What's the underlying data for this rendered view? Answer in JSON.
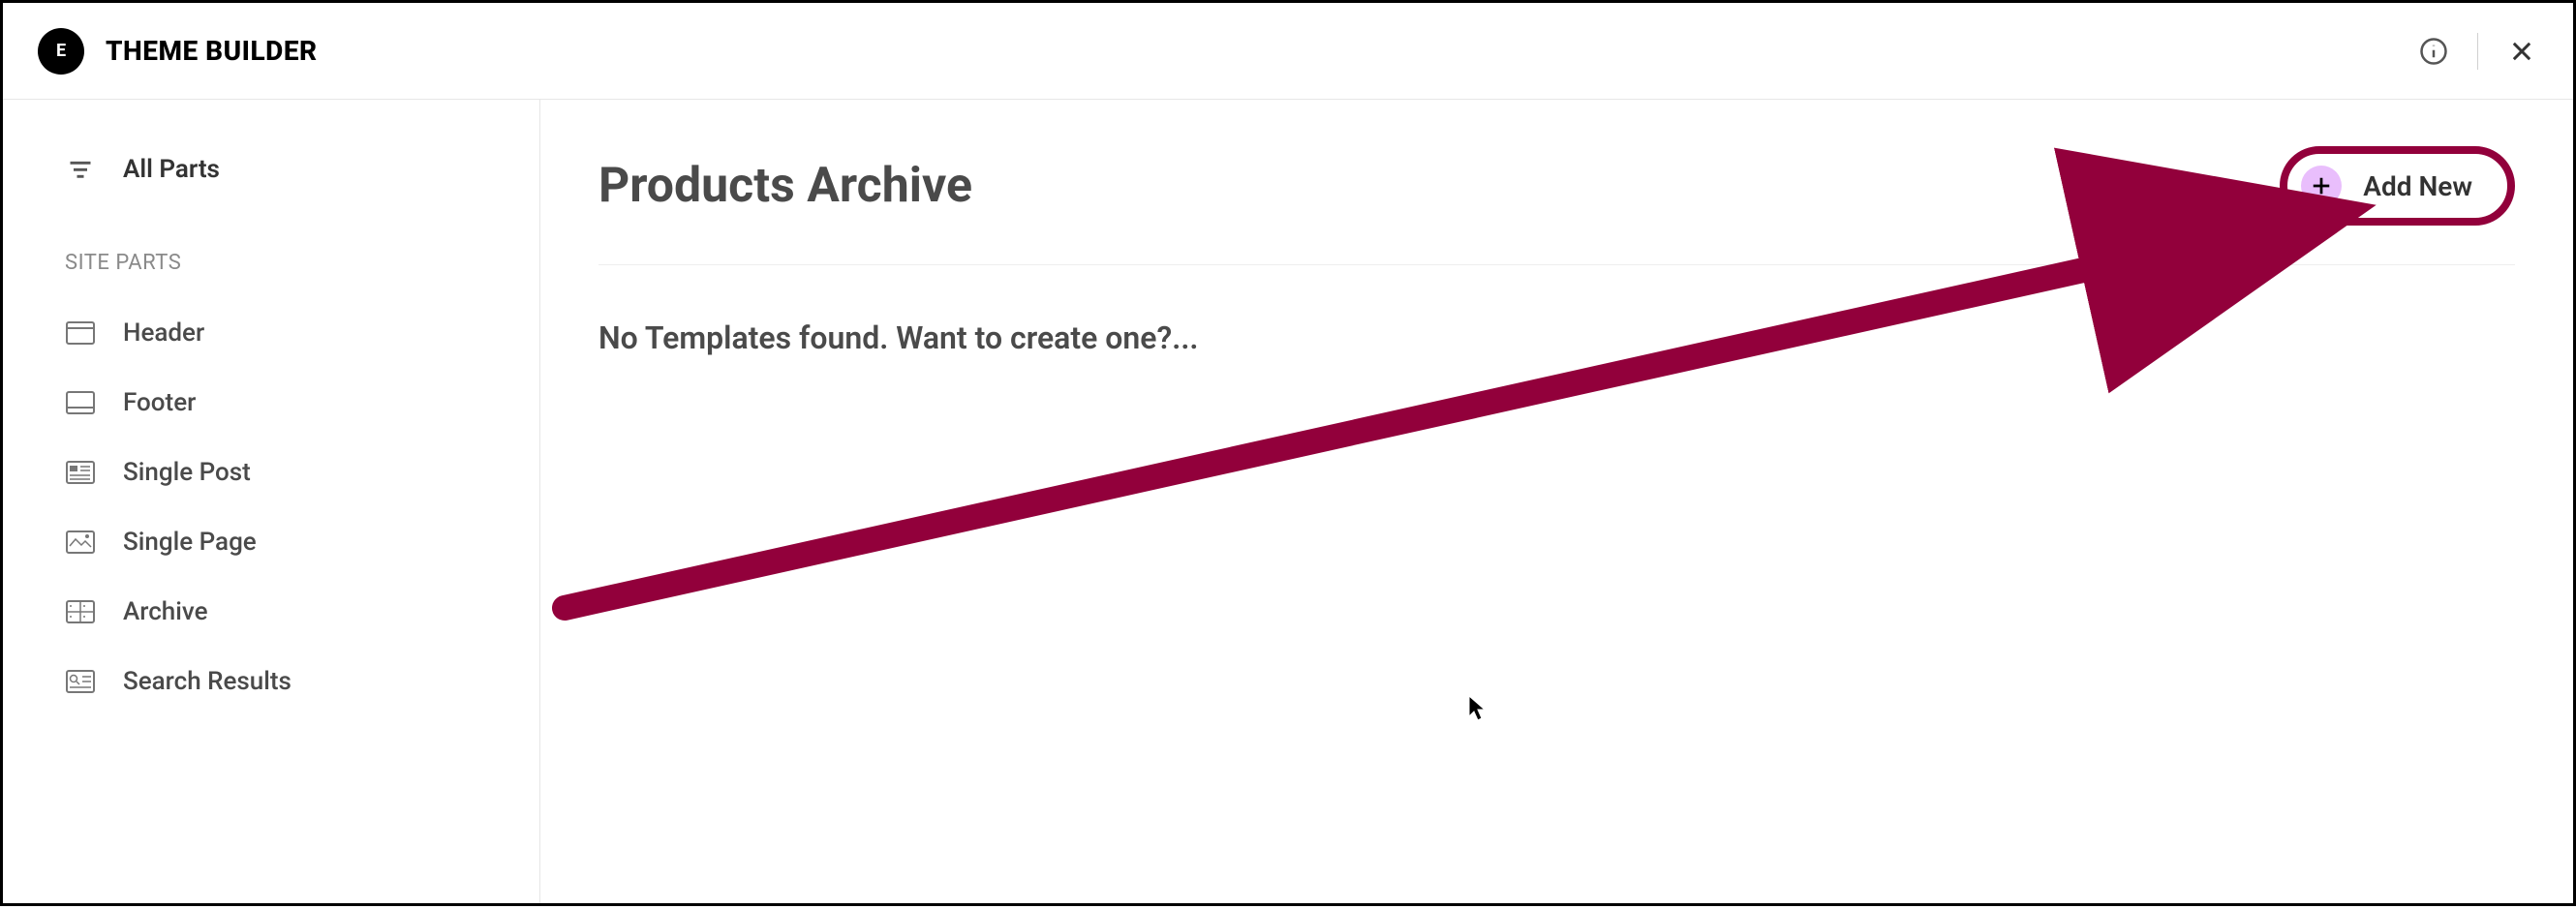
{
  "header": {
    "app_title": "THEME BUILDER",
    "logo_text": "E"
  },
  "sidebar": {
    "all_parts_label": "All Parts",
    "section_label": "SITE PARTS",
    "items": [
      {
        "label": "Header",
        "icon": "header-icon"
      },
      {
        "label": "Footer",
        "icon": "footer-icon"
      },
      {
        "label": "Single Post",
        "icon": "single-post-icon"
      },
      {
        "label": "Single Page",
        "icon": "single-page-icon"
      },
      {
        "label": "Archive",
        "icon": "archive-icon"
      },
      {
        "label": "Search Results",
        "icon": "search-results-icon"
      }
    ]
  },
  "main": {
    "title": "Products Archive",
    "add_new_label": "Add New",
    "empty_text": "No Templates found. Want to create one?..."
  },
  "annotation": {
    "color": "#92003b"
  }
}
